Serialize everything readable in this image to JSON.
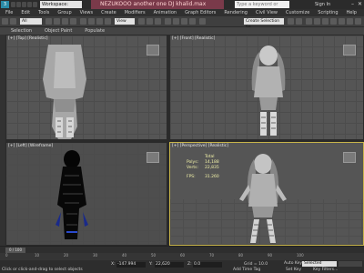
{
  "titlebar": {
    "app_icon": "3ds-max-icon",
    "workspace": "Workspace: Default",
    "document_title": "NEZUKOOO another one DJ khalid.max",
    "search_placeholder": "Type a keyword or phrase",
    "sign_in": "Sign In"
  },
  "menubar": {
    "items": [
      "File",
      "Edit",
      "Tools",
      "Group",
      "Views",
      "Create",
      "Modifiers",
      "Animation",
      "Graph Editors",
      "Rendering",
      "Civil View",
      "Customize",
      "Scripting",
      "Help"
    ]
  },
  "toolbar": {
    "selection_filter": "All",
    "view_dropdown": "View",
    "selection_set": "Create Selection Se"
  },
  "ribbon": {
    "tabs": [
      "Selection",
      "Object Paint",
      "Populate"
    ]
  },
  "viewports": {
    "top": "[+] [Top] [Realistic]",
    "front": "[+] [Front] [Realistic]",
    "left": "[+] [Left] [Wireframe]",
    "perspective": "[+] [Perspective] [Realistic]",
    "stats": {
      "header": "Total",
      "polys_label": "Polys:",
      "polys_value": "14,188",
      "verts_label": "Verts:",
      "verts_value": "22,835",
      "fps_label": "FPS:",
      "fps_value": "31.260"
    }
  },
  "timeslider": {
    "frame": "0 / 100",
    "ticks": [
      "0",
      "10",
      "20",
      "30",
      "40",
      "50",
      "60",
      "70",
      "80",
      "90",
      "100"
    ]
  },
  "statusbar": {
    "status_line": "Click or click-and-drag to select objects",
    "x_label": "X:",
    "x_value": "-147.994",
    "y_label": "Y:",
    "y_value": "22,620",
    "z_label": "Z:",
    "z_value": "0.0",
    "grid": "Grid = 10.0",
    "add_time_tag": "Add Time Tag",
    "auto_key": "Auto Key",
    "auto_key_selected": "Selected",
    "set_key": "Set Key",
    "key_filters": "Key Filters..."
  }
}
